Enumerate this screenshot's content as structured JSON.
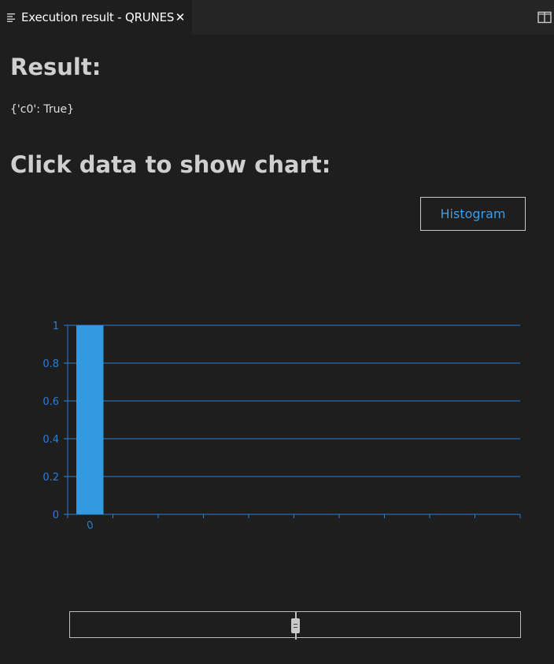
{
  "tab": {
    "title": "Execution result - QRUNES",
    "close_glyph": "✕",
    "icon": "preview-lines-icon"
  },
  "toolbar": {
    "split_icon": "split-editor-icon"
  },
  "result": {
    "heading": "Result:",
    "value": "{'c0': True}"
  },
  "chart_section": {
    "heading": "Click data to show chart:",
    "histogram_button": "Histogram"
  },
  "colors": {
    "background": "#1e1e1e",
    "accent": "#3d9de6",
    "bar": "#3399e0",
    "axis": "#2a7fd4"
  },
  "chart_data": {
    "type": "bar",
    "categories": [
      "0"
    ],
    "values": [
      1
    ],
    "ylim": [
      0,
      1
    ],
    "yticks": [
      "0",
      "0.2",
      "0.4",
      "0.6",
      "0.8",
      "1"
    ],
    "grid": true,
    "title": "",
    "xlabel": "",
    "ylabel": ""
  },
  "zoom_slider": {
    "handle_icon": "grip-icon"
  }
}
